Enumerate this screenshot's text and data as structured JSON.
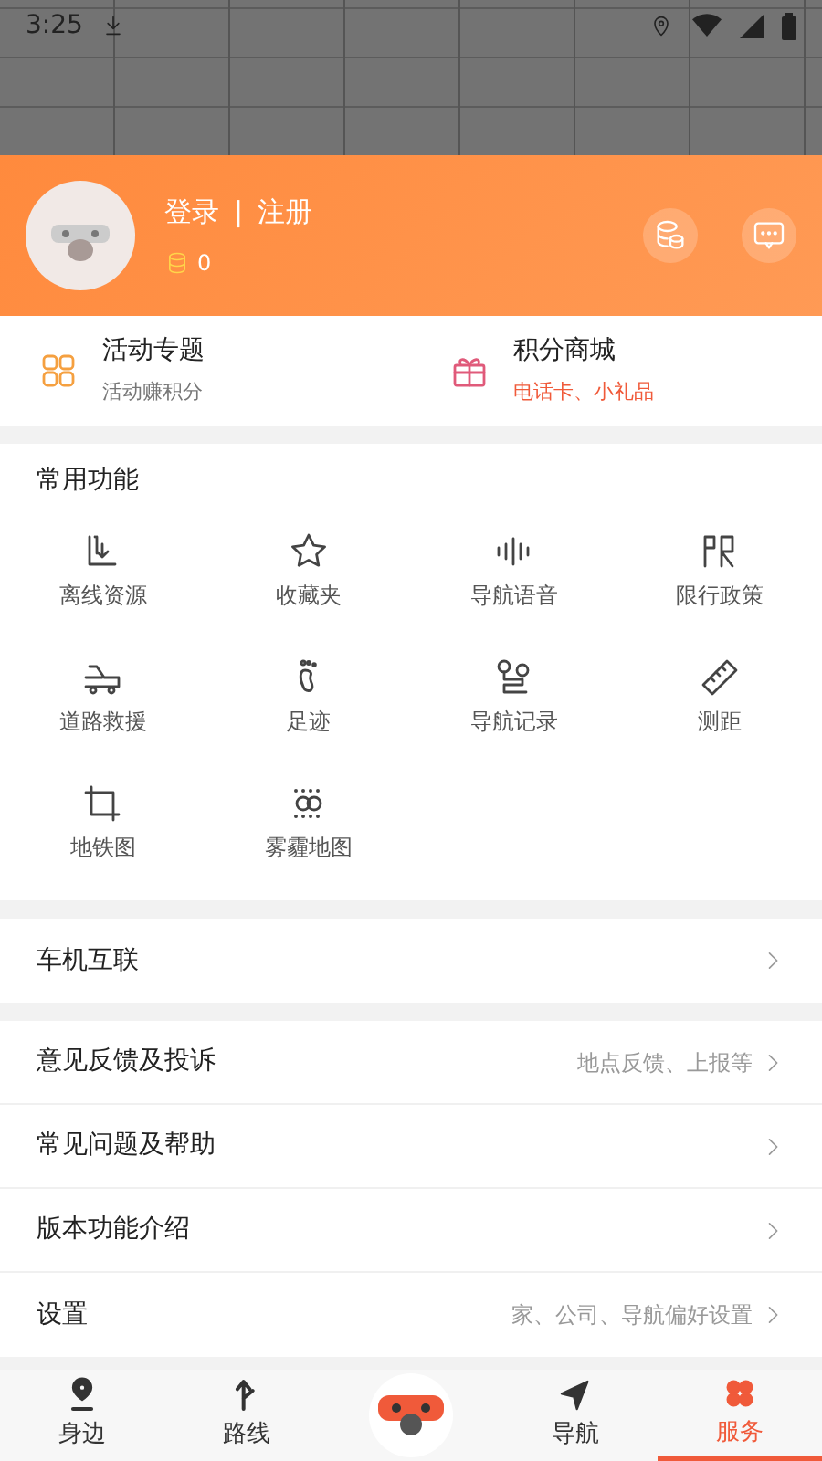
{
  "status_bar": {
    "time": "3:25"
  },
  "profile": {
    "login": "登录",
    "separator": "|",
    "register": "注册",
    "points": "0"
  },
  "promos": [
    {
      "kind": "activity",
      "title": "活动专题",
      "subtitle": "活动赚积分"
    },
    {
      "kind": "mall",
      "title": "积分商城",
      "subtitle": "电话卡、小礼品"
    }
  ],
  "common_functions": {
    "title": "常用功能",
    "items": [
      {
        "kind": "offline",
        "label": "离线资源"
      },
      {
        "kind": "star",
        "label": "收藏夹"
      },
      {
        "kind": "voice",
        "label": "导航语音"
      },
      {
        "kind": "limit",
        "label": "限行政策"
      },
      {
        "kind": "rescue",
        "label": "道路救援"
      },
      {
        "kind": "foot",
        "label": "足迹"
      },
      {
        "kind": "record",
        "label": "导航记录"
      },
      {
        "kind": "ruler",
        "label": "测距"
      },
      {
        "kind": "subway",
        "label": "地铁图"
      },
      {
        "kind": "fog",
        "label": "雾霾地图"
      }
    ]
  },
  "menu_groups": [
    [
      {
        "label": "车机互联"
      }
    ],
    [
      {
        "label": "意见反馈及投诉",
        "detail": "地点反馈、上报等"
      },
      {
        "label": "常见问题及帮助"
      },
      {
        "label": "版本功能介绍"
      },
      {
        "label": "设置",
        "detail": "家、公司、导航偏好设置"
      }
    ]
  ],
  "tabs": [
    {
      "kind": "nearby",
      "label": "身边",
      "selected": false
    },
    {
      "kind": "route",
      "label": "路线",
      "selected": false
    },
    {
      "kind": "center"
    },
    {
      "kind": "nav",
      "label": "导航",
      "selected": false
    },
    {
      "kind": "service",
      "label": "服务",
      "selected": true
    }
  ]
}
